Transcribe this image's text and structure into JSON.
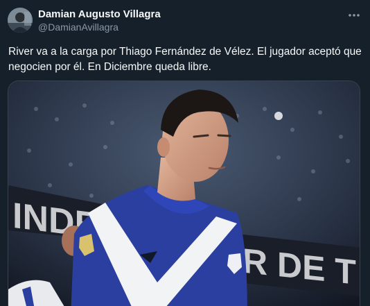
{
  "author": {
    "name": "Damian Augusto Villagra",
    "handle": "@DamianAvillagra",
    "avatar_icon": "profile-photo"
  },
  "tweet": {
    "text_lines": [
      "River va a la carga por Thiago Fernández de Vélez. El jugador aceptó que",
      "negocien por él. En Diciembre queda libre."
    ]
  },
  "media": {
    "description_icon": "photo-player-in-velez-jersey",
    "banner_left_letters": "INDE",
    "banner_right_letters": "R DE T"
  },
  "colors": {
    "background": "#15202b",
    "text_primary": "#f7f9f9",
    "text_secondary": "#8b98a5",
    "border": "#38444d",
    "jersey_blue": "#2b3fa0",
    "jersey_white": "#f2f3f5"
  }
}
